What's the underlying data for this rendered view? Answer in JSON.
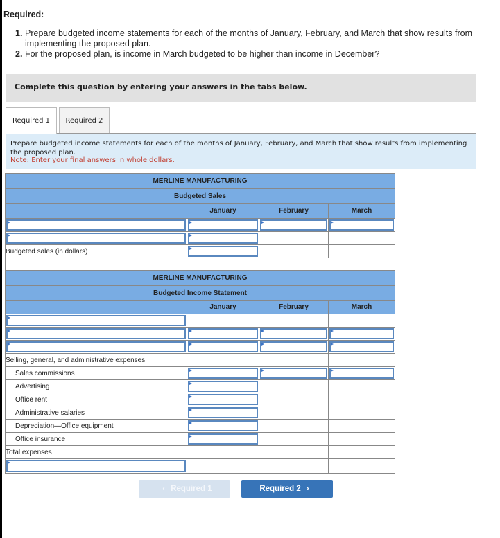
{
  "header": {
    "required_title": "Required:",
    "items": [
      {
        "num": "1.",
        "text": "Prepare budgeted income statements for each of the months of January, February, and March that show results from implementing the proposed plan."
      },
      {
        "num": "2.",
        "text": "For the proposed plan, is income in March budgeted to be higher than income in December?"
      }
    ]
  },
  "instruction": "Complete this question by entering your answers in the tabs below.",
  "tabs": [
    {
      "label": "Required 1",
      "active": true
    },
    {
      "label": "Required 2",
      "active": false
    }
  ],
  "prompt": {
    "text": "Prepare budgeted income statements for each of the months of January, February, and March that show results from implementing the proposed plan.",
    "note": "Note: Enter your final answers in whole dollars."
  },
  "sales_table": {
    "company": "MERLINE MANUFACTURING",
    "title": "Budgeted Sales",
    "columns": [
      "January",
      "February",
      "March"
    ],
    "rows": [
      {
        "label": "",
        "values": [
          "",
          "",
          ""
        ]
      },
      {
        "label": "",
        "values": [
          "",
          "",
          ""
        ]
      },
      {
        "label": "Budgeted sales (in dollars)",
        "values": [
          "",
          "",
          ""
        ]
      }
    ]
  },
  "income_table": {
    "company": "MERLINE MANUFACTURING",
    "title": "Budgeted Income Statement",
    "columns": [
      "January",
      "February",
      "March"
    ],
    "rows": [
      {
        "label": "",
        "values": [
          "",
          "",
          ""
        ]
      },
      {
        "label": "",
        "values": [
          "",
          "",
          ""
        ]
      },
      {
        "label": "",
        "values": [
          "",
          "",
          ""
        ]
      },
      {
        "label": "Selling, general, and administrative expenses",
        "values": [
          "",
          "",
          ""
        ]
      },
      {
        "label": "Sales commissions",
        "values": [
          "",
          "",
          ""
        ]
      },
      {
        "label": "Advertising",
        "values": [
          "",
          "",
          ""
        ]
      },
      {
        "label": "Office rent",
        "values": [
          "",
          "",
          ""
        ]
      },
      {
        "label": "Administrative salaries",
        "values": [
          "",
          "",
          ""
        ]
      },
      {
        "label": "Depreciation—Office equipment",
        "values": [
          "",
          "",
          ""
        ]
      },
      {
        "label": "Office insurance",
        "values": [
          "",
          "",
          ""
        ]
      },
      {
        "label": "Total expenses",
        "values": [
          "",
          "",
          ""
        ]
      },
      {
        "label": "",
        "values": [
          "",
          "",
          ""
        ]
      }
    ]
  },
  "nav": {
    "prev_label": "Required 1",
    "next_label": "Required 2",
    "prev_icon": "chevron-left-icon",
    "next_icon": "chevron-right-icon"
  }
}
